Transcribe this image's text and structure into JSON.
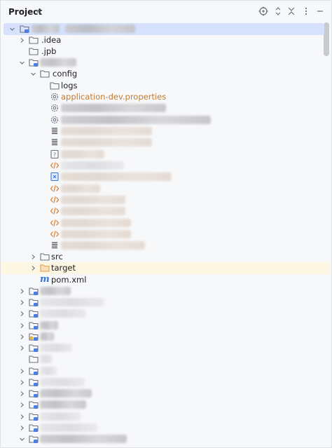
{
  "header": {
    "title": "Project",
    "icons": [
      "chevron-down-icon",
      "locate-icon",
      "expand-collapse-icon",
      "collapse-all-icon",
      "more-options-icon"
    ]
  },
  "tree": {
    "idea": ".idea",
    "jpb": ".jpb",
    "config": "config",
    "logs": "logs",
    "application_dev": "application-dev.properties",
    "src": "src",
    "target": "target",
    "pom": "pom.xml"
  },
  "colors": {
    "selection": "#d5e1fd",
    "target_highlight": "#fdf6e3",
    "excluded_folder": "#e8a04a",
    "module_badge": "#4a7fe0",
    "properties_text": "#c27b33",
    "xml_icon": "#e07b2a",
    "maven_icon": "#3874d8"
  }
}
